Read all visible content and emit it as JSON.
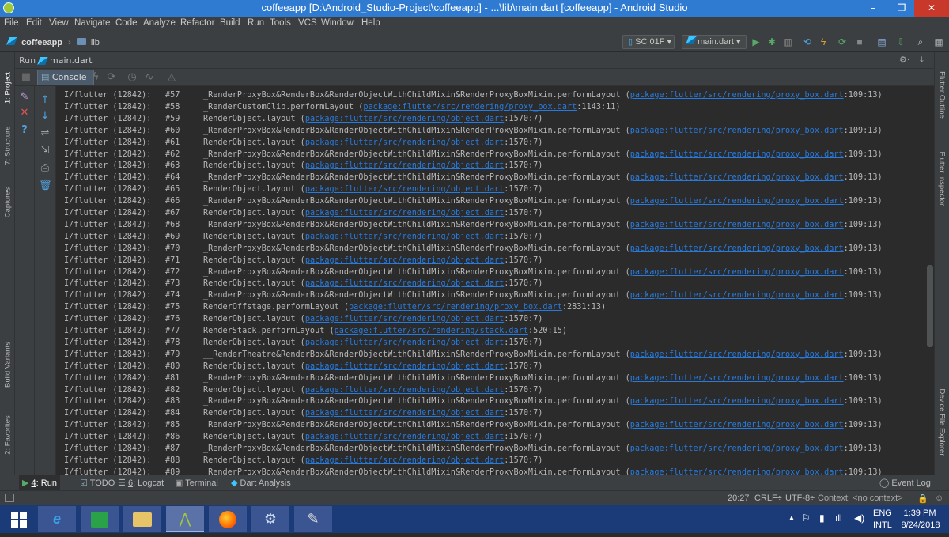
{
  "window": {
    "title": "coffeeapp [D:\\Android_Studio-Project\\coffeeapp] - ...\\lib\\main.dart [coffeeapp] - Android Studio",
    "minimize": "–",
    "restore": "❐",
    "close": "✕"
  },
  "menu": [
    "File",
    "Edit",
    "View",
    "Navigate",
    "Code",
    "Analyze",
    "Refactor",
    "Build",
    "Run",
    "Tools",
    "VCS",
    "Window",
    "Help"
  ],
  "nav": {
    "project": "coffeeapp",
    "folder": "lib",
    "device": "SC 01F ▾",
    "run_config": "main.dart ▾"
  },
  "run_panel": {
    "run_label": "Run",
    "file": "main.dart",
    "console_tab": "Console"
  },
  "left_tools": [
    "1: Project",
    "7: Structure",
    "Captures",
    "Build Variants",
    "2: Favorites"
  ],
  "right_tools": [
    "Flutter Outline",
    "Flutter Inspector",
    "Device File Explorer"
  ],
  "console": {
    "prefix": "I/flutter (12842):",
    "lines": [
      {
        "n": "#57",
        "text": "_RenderProxyBox&RenderBox&RenderObjectWithChildMixin&RenderProxyBoxMixin.performLayout (",
        "link": "package:flutter/src/rendering/proxy_box.dart",
        "loc": ":109:13)"
      },
      {
        "n": "#58",
        "text": "_RenderCustomClip.performLayout (",
        "link": "package:flutter/src/rendering/proxy_box.dart",
        "loc": ":1143:11)"
      },
      {
        "n": "#59",
        "text": "RenderObject.layout (",
        "link": "package:flutter/src/rendering/object.dart",
        "loc": ":1570:7)"
      },
      {
        "n": "#60",
        "text": "_RenderProxyBox&RenderBox&RenderObjectWithChildMixin&RenderProxyBoxMixin.performLayout (",
        "link": "package:flutter/src/rendering/proxy_box.dart",
        "loc": ":109:13)"
      },
      {
        "n": "#61",
        "text": "RenderObject.layout (",
        "link": "package:flutter/src/rendering/object.dart",
        "loc": ":1570:7)"
      },
      {
        "n": "#62",
        "text": "_RenderProxyBox&RenderBox&RenderObjectWithChildMixin&RenderProxyBoxMixin.performLayout (",
        "link": "package:flutter/src/rendering/proxy_box.dart",
        "loc": ":109:13)"
      },
      {
        "n": "#63",
        "text": "RenderObject.layout (",
        "link": "package:flutter/src/rendering/object.dart",
        "loc": ":1570:7)"
      },
      {
        "n": "#64",
        "text": "_RenderProxyBox&RenderBox&RenderObjectWithChildMixin&RenderProxyBoxMixin.performLayout (",
        "link": "package:flutter/src/rendering/proxy_box.dart",
        "loc": ":109:13)"
      },
      {
        "n": "#65",
        "text": "RenderObject.layout (",
        "link": "package:flutter/src/rendering/object.dart",
        "loc": ":1570:7)"
      },
      {
        "n": "#66",
        "text": "_RenderProxyBox&RenderBox&RenderObjectWithChildMixin&RenderProxyBoxMixin.performLayout (",
        "link": "package:flutter/src/rendering/proxy_box.dart",
        "loc": ":109:13)"
      },
      {
        "n": "#67",
        "text": "RenderObject.layout (",
        "link": "package:flutter/src/rendering/object.dart",
        "loc": ":1570:7)"
      },
      {
        "n": "#68",
        "text": "_RenderProxyBox&RenderBox&RenderObjectWithChildMixin&RenderProxyBoxMixin.performLayout (",
        "link": "package:flutter/src/rendering/proxy_box.dart",
        "loc": ":109:13)"
      },
      {
        "n": "#69",
        "text": "RenderObject.layout (",
        "link": "package:flutter/src/rendering/object.dart",
        "loc": ":1570:7)"
      },
      {
        "n": "#70",
        "text": "_RenderProxyBox&RenderBox&RenderObjectWithChildMixin&RenderProxyBoxMixin.performLayout (",
        "link": "package:flutter/src/rendering/proxy_box.dart",
        "loc": ":109:13)"
      },
      {
        "n": "#71",
        "text": "RenderObject.layout (",
        "link": "package:flutter/src/rendering/object.dart",
        "loc": ":1570:7)"
      },
      {
        "n": "#72",
        "text": "_RenderProxyBox&RenderBox&RenderObjectWithChildMixin&RenderProxyBoxMixin.performLayout (",
        "link": "package:flutter/src/rendering/proxy_box.dart",
        "loc": ":109:13)"
      },
      {
        "n": "#73",
        "text": "RenderObject.layout (",
        "link": "package:flutter/src/rendering/object.dart",
        "loc": ":1570:7)"
      },
      {
        "n": "#74",
        "text": "_RenderProxyBox&RenderBox&RenderObjectWithChildMixin&RenderProxyBoxMixin.performLayout (",
        "link": "package:flutter/src/rendering/proxy_box.dart",
        "loc": ":109:13)"
      },
      {
        "n": "#75",
        "text": "RenderOffstage.performLayout (",
        "link": "package:flutter/src/rendering/proxy_box.dart",
        "loc": ":2831:13)"
      },
      {
        "n": "#76",
        "text": "RenderObject.layout (",
        "link": "package:flutter/src/rendering/object.dart",
        "loc": ":1570:7)"
      },
      {
        "n": "#77",
        "text": "RenderStack.performLayout (",
        "link": "package:flutter/src/rendering/stack.dart",
        "loc": ":520:15)"
      },
      {
        "n": "#78",
        "text": "RenderObject.layout (",
        "link": "package:flutter/src/rendering/object.dart",
        "loc": ":1570:7)"
      },
      {
        "n": "#79",
        "text": "__RenderTheatre&RenderBox&RenderObjectWithChildMixin&RenderProxyBoxMixin.performLayout (",
        "link": "package:flutter/src/rendering/proxy_box.dart",
        "loc": ":109:13)"
      },
      {
        "n": "#80",
        "text": "RenderObject.layout (",
        "link": "package:flutter/src/rendering/object.dart",
        "loc": ":1570:7)"
      },
      {
        "n": "#81",
        "text": "_RenderProxyBox&RenderBox&RenderObjectWithChildMixin&RenderProxyBoxMixin.performLayout (",
        "link": "package:flutter/src/rendering/proxy_box.dart",
        "loc": ":109:13)"
      },
      {
        "n": "#82",
        "text": "RenderObject.layout (",
        "link": "package:flutter/src/rendering/object.dart",
        "loc": ":1570:7)"
      },
      {
        "n": "#83",
        "text": "_RenderProxyBox&RenderBox&RenderObjectWithChildMixin&RenderProxyBoxMixin.performLayout (",
        "link": "package:flutter/src/rendering/proxy_box.dart",
        "loc": ":109:13)"
      },
      {
        "n": "#84",
        "text": "RenderObject.layout (",
        "link": "package:flutter/src/rendering/object.dart",
        "loc": ":1570:7)"
      },
      {
        "n": "#85",
        "text": "_RenderProxyBox&RenderBox&RenderObjectWithChildMixin&RenderProxyBoxMixin.performLayout (",
        "link": "package:flutter/src/rendering/proxy_box.dart",
        "loc": ":109:13)"
      },
      {
        "n": "#86",
        "text": "RenderObject.layout (",
        "link": "package:flutter/src/rendering/object.dart",
        "loc": ":1570:7)"
      },
      {
        "n": "#87",
        "text": "_RenderProxyBox&RenderBox&RenderObjectWithChildMixin&RenderProxyBoxMixin.performLayout (",
        "link": "package:flutter/src/rendering/proxy_box.dart",
        "loc": ":109:13)"
      },
      {
        "n": "#88",
        "text": "RenderObject.layout (",
        "link": "package:flutter/src/rendering/object.dart",
        "loc": ":1570:7)"
      },
      {
        "n": "#89",
        "text": "_RenderProxyBox&RenderBox&RenderObjectWithChildMixin&RenderProxyBoxMixin.performLayout (",
        "link": "package:flutter/src/rendering/proxy_box.dart",
        "loc": ":109:13)"
      }
    ]
  },
  "bottom_tabs": [
    {
      "num": "4",
      "label": ": Run",
      "icon": "▶"
    },
    {
      "num": "",
      "label": "TODO",
      "icon": "☑"
    },
    {
      "num": "6",
      "label": ": Logcat",
      "icon": "☰"
    },
    {
      "num": "",
      "label": "Terminal",
      "icon": "▣"
    },
    {
      "num": "",
      "label": "Dart Analysis",
      "icon": "◆"
    }
  ],
  "event_log": "Event Log",
  "status": {
    "position": "20:27",
    "line_sep": "CRLF÷",
    "encoding": "UTF-8÷",
    "context": "Context: <no context>"
  },
  "taskbar": {
    "lang1": "ENG",
    "lang2": "INTL",
    "time": "1:39 PM",
    "date": "8/24/2018"
  },
  "colors": {
    "accent": "#2f7bd1",
    "link": "#287bde",
    "bg": "#2b2b2b",
    "panel": "#3c3f41"
  }
}
